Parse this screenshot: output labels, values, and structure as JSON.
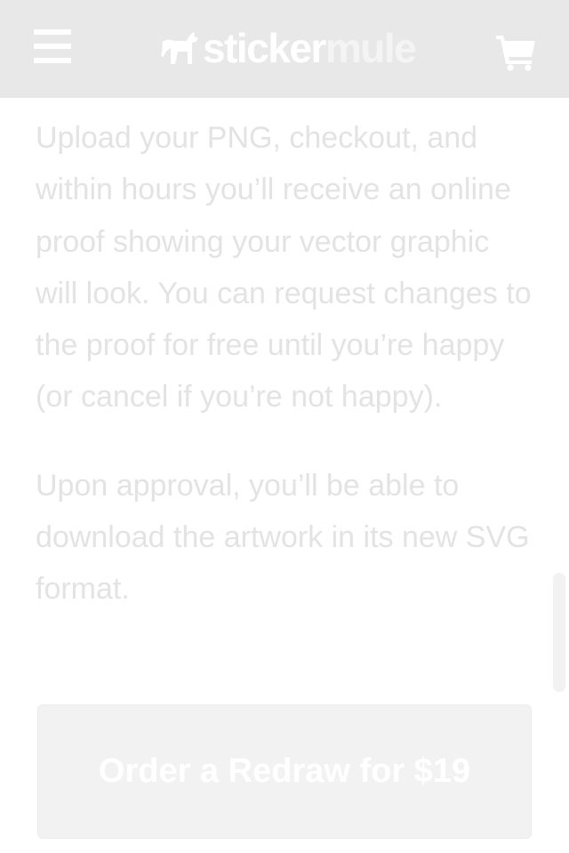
{
  "header": {
    "logo_part1": "sticker",
    "logo_part2": "mule",
    "menu_icon": "hamburger-menu-icon",
    "cart_icon": "shopping-cart-icon",
    "logo_icon": "mule-icon"
  },
  "content": {
    "paragraphs": [
      "Upload your PNG, checkout, and within hours you’ll receive an online proof showing your vector graphic will look. You can request changes to the proof for free until you’re happy (or cancel if you’re not happy).",
      "Upon approval, you’ll be able to download the artwork in its new SVG format."
    ]
  },
  "cta": {
    "label": "Order a Redraw for $19"
  },
  "colors": {
    "header_bg": "#e8e8e8",
    "text": "#e3e3e3",
    "button_bg": "#f2f2f2"
  }
}
